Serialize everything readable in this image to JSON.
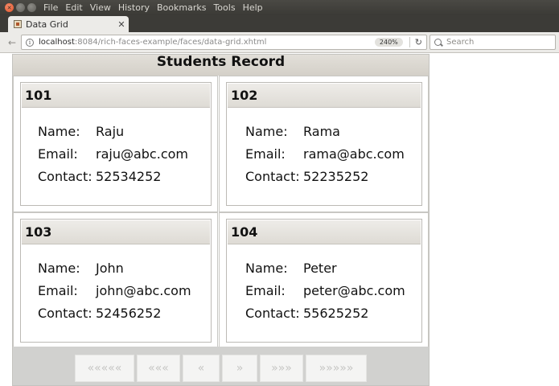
{
  "browser": {
    "menu_items": [
      "File",
      "Edit",
      "View",
      "History",
      "Bookmarks",
      "Tools",
      "Help"
    ],
    "tab_title": "Data Grid",
    "tab_close": "✕",
    "new_tab": "+",
    "url_host": "localhost",
    "url_path": ":8084/rich-faces-example/faces/data-grid.xhtml",
    "zoom": "240%",
    "search_placeholder": "Search"
  },
  "grid": {
    "title": "Students Record",
    "labels": {
      "name": "Name:",
      "email": "Email:",
      "contact": "Contact:"
    },
    "students": [
      {
        "id": "101",
        "name": "Raju",
        "email": "raju@abc.com",
        "contact": "52534252"
      },
      {
        "id": "102",
        "name": "Rama",
        "email": "rama@abc.com",
        "contact": "52235252"
      },
      {
        "id": "103",
        "name": "John",
        "email": "john@abc.com",
        "contact": "52456252"
      },
      {
        "id": "104",
        "name": "Peter",
        "email": "peter@abc.com",
        "contact": "55625252"
      }
    ]
  },
  "pager": {
    "first": "«««««",
    "fast_back": "«««",
    "prev": "«",
    "next": "»",
    "fast_forward": "»»»",
    "last": "»»»»»"
  }
}
